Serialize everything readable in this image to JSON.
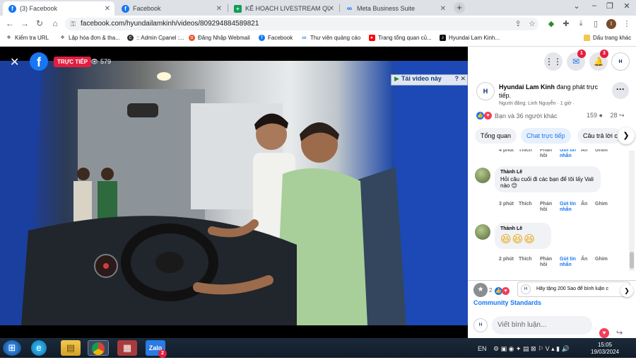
{
  "browser": {
    "tabs": [
      {
        "title": "(3) Facebook",
        "icon": "facebook-icon"
      },
      {
        "title": "Facebook",
        "icon": "facebook-icon"
      },
      {
        "title": "KẾ HOẠCH LIVESTREAM QUÝ I &",
        "icon": "sheets-icon"
      },
      {
        "title": "Meta Business Suite",
        "icon": "meta-icon"
      }
    ],
    "url": "facebook.com/hyundailamkinh/videos/809294884589821",
    "profile_initial": "I",
    "bookmarks": [
      {
        "label": "Kiểm tra URL",
        "icon": "bookmark-icon"
      },
      {
        "label": "Lập hóa đơn & tha...",
        "icon": "bookmark-icon"
      },
      {
        "label": ":: Admin Cpanel :...",
        "icon": "cpanel-icon"
      },
      {
        "label": "Đăng Nhập Webmail",
        "icon": "webmail-icon"
      },
      {
        "label": "Facebook",
        "icon": "facebook-icon"
      },
      {
        "label": "Thư viện quảng cáo",
        "icon": "meta-icon"
      },
      {
        "label": "Trang tổng quan củ...",
        "icon": "youtube-icon"
      },
      {
        "label": "Hyundai Lam Kinh...",
        "icon": "tiktok-icon"
      }
    ],
    "bookmarks_other": "Dấu trang khác"
  },
  "video": {
    "live_label": "TRỰC TIẾP",
    "viewer_count": "579",
    "download_label": "Tải video này",
    "help_label": "?"
  },
  "panel": {
    "messenger_badge": "1",
    "notification_badge": "3",
    "page_avatar_text": "HYUNDAI",
    "page_name": "Hyundai Lam Kinh",
    "page_status": " đang phát trực tiếp.",
    "posted_by": "Người đăng: Linh Nguyễn · 1 giờ ·",
    "reactions_text": "Bạn và 36 người khác",
    "comment_count": "159",
    "share_count": "28",
    "tabs": [
      "Tổng quan",
      "Chat trực tiếp",
      "Câu trả lời c"
    ],
    "partial_top": {
      "time": "4 phút",
      "like": "Thích",
      "reply": "Phản hồi",
      "send": "Gửi tin nhắn",
      "hide": "Ẩn",
      "pin": "Ghim"
    },
    "comments": [
      {
        "author": "Thành Lê",
        "text": "Hỏi câu cuối đi các bạn để tôi lấy Vali nào 😊",
        "time": "3 phút",
        "like": "Thích",
        "reply": "Phản hồi",
        "send": "Gửi tin nhắn",
        "hide": "Ẩn",
        "pin": "Ghim"
      },
      {
        "author": "Thành Lê",
        "text": "😆😆😆",
        "time": "2 phút",
        "like": "Thích",
        "reply": "Phản hồi",
        "send": "Gửi tin nhắn",
        "hide": "Ẩn",
        "pin": "Ghim"
      }
    ],
    "reaction_count_bottom": "2",
    "star_prompt": "Hãy tặng 200 Sao để bình luận c",
    "community_standards": "Community Standards",
    "comment_placeholder": "Viết bình luận..."
  },
  "taskbar": {
    "language": "EN",
    "time": "15:05",
    "date": "19/03/2024",
    "zalo_badge": "2"
  },
  "colors": {
    "facebook_blue": "#1877f2",
    "live_red": "#e41e3f"
  }
}
